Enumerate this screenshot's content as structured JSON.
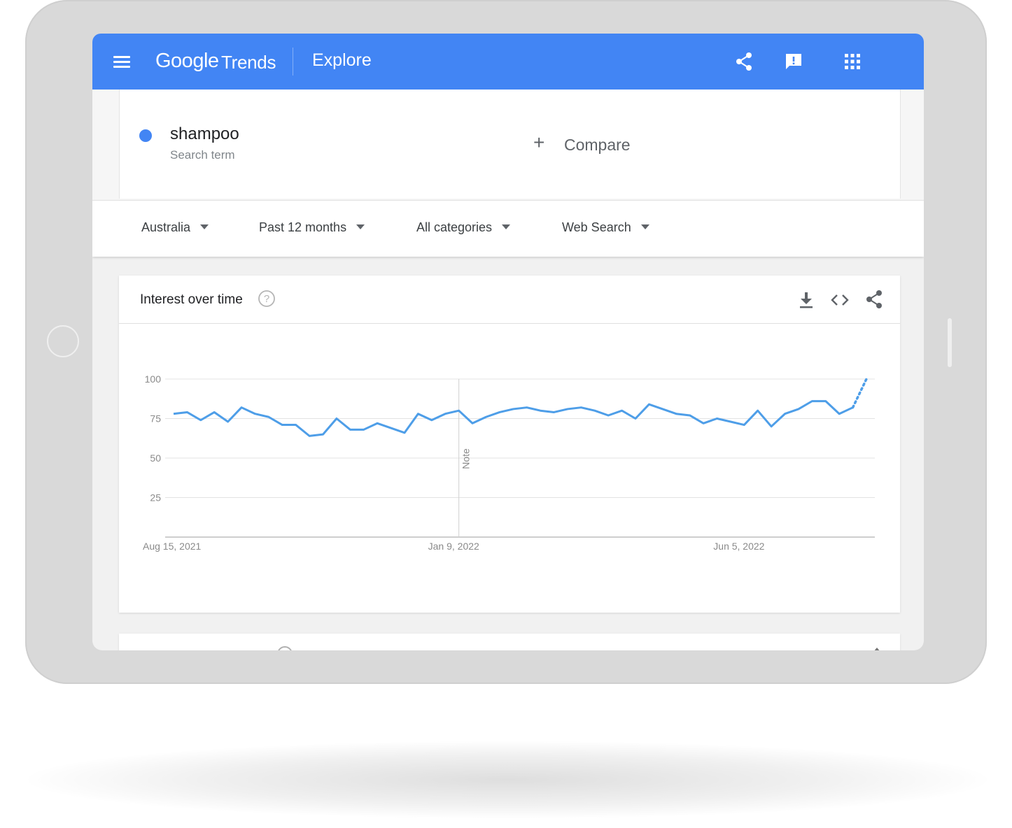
{
  "appbar": {
    "logo_google": "Google",
    "logo_trends": "Trends",
    "page": "Explore",
    "color": "#4285f4",
    "icons": [
      "menu-icon",
      "share-icon",
      "feedback-icon",
      "apps-icon"
    ]
  },
  "search": {
    "term": "shampoo",
    "term_type": "Search term",
    "term_color": "#4285f4",
    "compare_label": "Compare"
  },
  "filters": {
    "region": "Australia",
    "time": "Past 12 months",
    "category": "All categories",
    "property": "Web Search"
  },
  "interest_card": {
    "title": "Interest over time",
    "icons": [
      "help-icon",
      "download-icon",
      "embed-icon",
      "share-icon"
    ]
  },
  "chart_data": {
    "type": "line",
    "title": "",
    "ylim": [
      0,
      100
    ],
    "y_ticks": [
      "100",
      "75",
      "50",
      "25"
    ],
    "x_tick_labels": [
      "Aug 15, 2021",
      "Jan 9, 2022",
      "Jun 5, 2022"
    ],
    "note_label": "Note",
    "note_at": "Jan 9, 2022",
    "grid": true,
    "series": [
      {
        "color": "#4e9ee8",
        "x": [
          "2021-08-15",
          "2021-08-22",
          "2021-08-29",
          "2021-09-05",
          "2021-09-12",
          "2021-09-19",
          "2021-09-26",
          "2021-10-03",
          "2021-10-10",
          "2021-10-17",
          "2021-10-24",
          "2021-10-31",
          "2021-11-07",
          "2021-11-14",
          "2021-11-21",
          "2021-11-28",
          "2021-12-05",
          "2021-12-12",
          "2021-12-19",
          "2021-12-26",
          "2022-01-02",
          "2022-01-09",
          "2022-01-16",
          "2022-01-23",
          "2022-01-30",
          "2022-02-06",
          "2022-02-13",
          "2022-02-20",
          "2022-02-27",
          "2022-03-06",
          "2022-03-13",
          "2022-03-20",
          "2022-03-27",
          "2022-04-03",
          "2022-04-10",
          "2022-04-17",
          "2022-04-24",
          "2022-05-01",
          "2022-05-08",
          "2022-05-15",
          "2022-05-22",
          "2022-05-29",
          "2022-06-05",
          "2022-06-12",
          "2022-06-19",
          "2022-06-26",
          "2022-07-03",
          "2022-07-10",
          "2022-07-17",
          "2022-07-24",
          "2022-07-31",
          "2022-08-07"
        ],
        "values": [
          78,
          79,
          74,
          79,
          73,
          82,
          78,
          76,
          71,
          71,
          64,
          65,
          75,
          68,
          68,
          72,
          69,
          66,
          78,
          74,
          78,
          80,
          72,
          76,
          79,
          81,
          82,
          80,
          79,
          81,
          82,
          80,
          77,
          80,
          75,
          84,
          81,
          78,
          77,
          72,
          75,
          73,
          71,
          80,
          70,
          78,
          81,
          86,
          86,
          78,
          82,
          100
        ],
        "partial_last_point": true
      }
    ]
  }
}
